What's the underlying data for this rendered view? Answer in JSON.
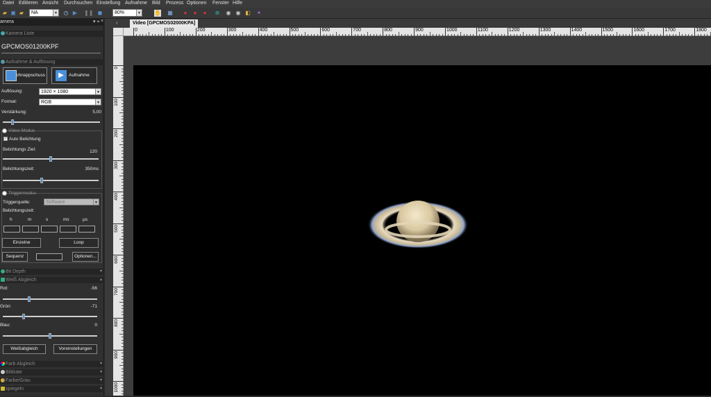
{
  "menu": [
    "Datei",
    "Editieren",
    "Ansicht",
    "Durchsuchen",
    "Einstellung",
    "Aufnahme",
    "Bild",
    "Prozess",
    "Optionen",
    "Fenster",
    "Hilfe"
  ],
  "toolbar": {
    "combo1": "NA",
    "zoom": "80%"
  },
  "panel": {
    "title": "amera",
    "camera_list_header": "Kamera Liste",
    "camera_name": "GPCMOS01200KPF",
    "capture_header": "Aufnahme & Auflösung",
    "snapshot_label": "Schnappschuss",
    "record_label": "Aufnahme",
    "resolution_label": "Auflösung:",
    "resolution_value": "1920 × 1080",
    "format_label": "Format:",
    "format_value": "RGB",
    "gain_label": "Verstärkung:",
    "gain_value": "5,00",
    "gain_level": 0.09,
    "video_mode_label": "Video-Modus",
    "auto_exposure_label": "Auto Belichtung",
    "exposure_target_label": "Belichtungs Ziel:",
    "exposure_target_value": "120",
    "exposure_target_level": 0.5,
    "exposure_time_label": "Belichtungszeit:",
    "exposure_time_value": "350ms",
    "exposure_time_level": 0.4,
    "trigger_mode_label": "Triggermodus",
    "trigger_source_label": "Triggerquelle:",
    "trigger_source_value": "Software",
    "trigger_exposure_label": "Belichtungszeit:",
    "time_units": [
      "h",
      "m",
      "s",
      "ms",
      "µs"
    ],
    "single_button": "Einzelne",
    "loop_button": "Loop",
    "sequence_button": "Sequenz",
    "options_button": "Optionen...",
    "bit_depth_header": "Bit Depth",
    "white_balance_header": "Weiß Abgleich",
    "red_label": "Rot:",
    "red_value": "-56",
    "red_level": 0.27,
    "green_label": "Grün:",
    "green_value": "-71",
    "green_level": 0.21,
    "blue_label": "Blau:",
    "blue_value": "0",
    "blue_level": 0.5,
    "white_balance_button": "Weißabgleich",
    "defaults_button": "Voreinstellungen",
    "color_balance_header": "Farb Abgleich",
    "frame_rate_header": "Bildrate",
    "color_gray_header": "Farbe/Grau",
    "mirror_header": "spiegeln"
  },
  "workspace": {
    "tab_title": "Video [GPCMOS02000KPA]",
    "h_ruler_ticks": [
      "0",
      "100",
      "200",
      "300",
      "400",
      "500",
      "600",
      "700",
      "800",
      "900",
      "1000",
      "1100",
      "1200",
      "1300",
      "1400",
      "1500",
      "1600",
      "1700",
      "1800"
    ],
    "v_ruler_ticks": [
      "0",
      "100",
      "200",
      "300",
      "400",
      "500",
      "600",
      "700",
      "800",
      "900",
      "1000"
    ]
  }
}
